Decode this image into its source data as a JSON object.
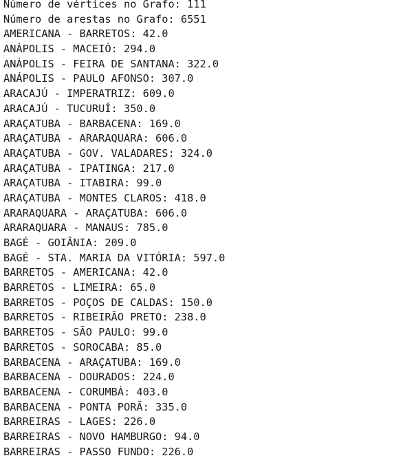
{
  "console": {
    "lines": [
      "Número de vértices no Grafo: 111",
      "Número de arestas no Grafo: 6551",
      "AMERICANA - BARRETOS: 42.0",
      "ANÁPOLIS - MACEIÓ: 294.0",
      "ANÁPOLIS - FEIRA DE SANTANA: 322.0",
      "ANÁPOLIS - PAULO AFONSO: 307.0",
      "ARACAJÚ - IMPERATRIZ: 609.0",
      "ARACAJÚ - TUCURUÍ: 350.0",
      "ARAÇATUBA - BARBACENA: 169.0",
      "ARAÇATUBA - ARARAQUARA: 606.0",
      "ARAÇATUBA - GOV. VALADARES: 324.0",
      "ARAÇATUBA - IPATINGA: 217.0",
      "ARAÇATUBA - ITABIRA: 99.0",
      "ARAÇATUBA - MONTES CLAROS: 418.0",
      "ARARAQUARA - ARAÇATUBA: 606.0",
      "ARARAQUARA - MANAUS: 785.0",
      "BAGÉ - GOIÂNIA: 209.0",
      "BAGÉ - STA. MARIA DA VITÓRIA: 597.0",
      "BARRETOS - AMERICANA: 42.0",
      "BARRETOS - LIMEIRA: 65.0",
      "BARRETOS - POÇOS DE CALDAS: 150.0",
      "BARRETOS - RIBEIRÃO PRETO: 238.0",
      "BARRETOS - SÃO PAULO: 99.0",
      "BARRETOS - SOROCABA: 85.0",
      "BARBACENA - ARAÇATUBA: 169.0",
      "BARBACENA - DOURADOS: 224.0",
      "BARBACENA - CORUMBÁ: 403.0",
      "BARBACENA - PONTA PORÃ: 335.0",
      "BARREIRAS - LAGES: 226.0",
      "BARREIRAS - NOVO HAMBURGO: 94.0",
      "BARREIRAS - PASSO FUNDO: 226.0"
    ]
  }
}
